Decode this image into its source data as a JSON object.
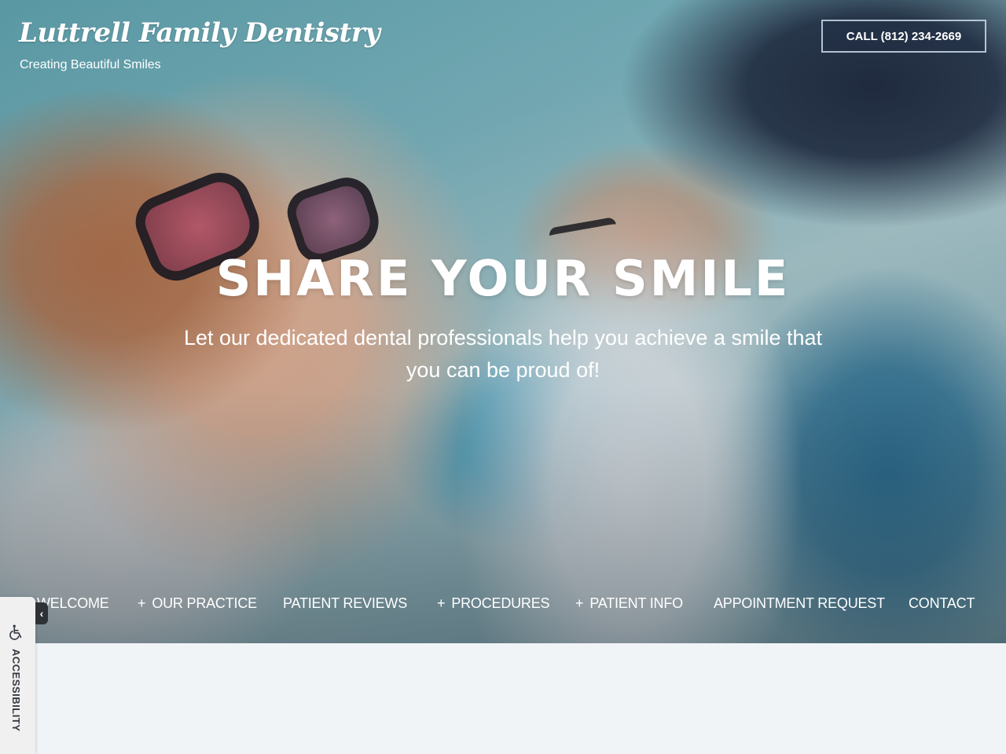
{
  "header": {
    "logo_title": "Luttrell Family Dentistry",
    "tagline": "Creating Beautiful Smiles",
    "call_button": "CALL (812) 234-2669"
  },
  "hero": {
    "heading": "SHARE YOUR SMILE",
    "subheading": "Let our dedicated dental professionals help you achieve a smile that you can be proud of!",
    "image_description": "woman in sun hat and sunglasses laughing with man driving convertible"
  },
  "nav": {
    "items": [
      {
        "label": "WELCOME",
        "has_submenu": false
      },
      {
        "label": "OUR PRACTICE",
        "has_submenu": true
      },
      {
        "label": "PATIENT REVIEWS",
        "has_submenu": false
      },
      {
        "label": "PROCEDURES",
        "has_submenu": true
      },
      {
        "label": "PATIENT INFO",
        "has_submenu": true
      },
      {
        "label": "APPOINTMENT REQUEST",
        "has_submenu": false
      },
      {
        "label": "CONTACT",
        "has_submenu": false
      }
    ],
    "submenu_indicator": "+"
  },
  "accessibility": {
    "label": "ACCESSIBILITY",
    "toggle_glyph": "‹",
    "icon": "wheelchair-icon"
  },
  "colors": {
    "page_background": "#f1f4f7",
    "accessibility_tab": "#f0f0f0",
    "text_light": "#ffffff"
  }
}
